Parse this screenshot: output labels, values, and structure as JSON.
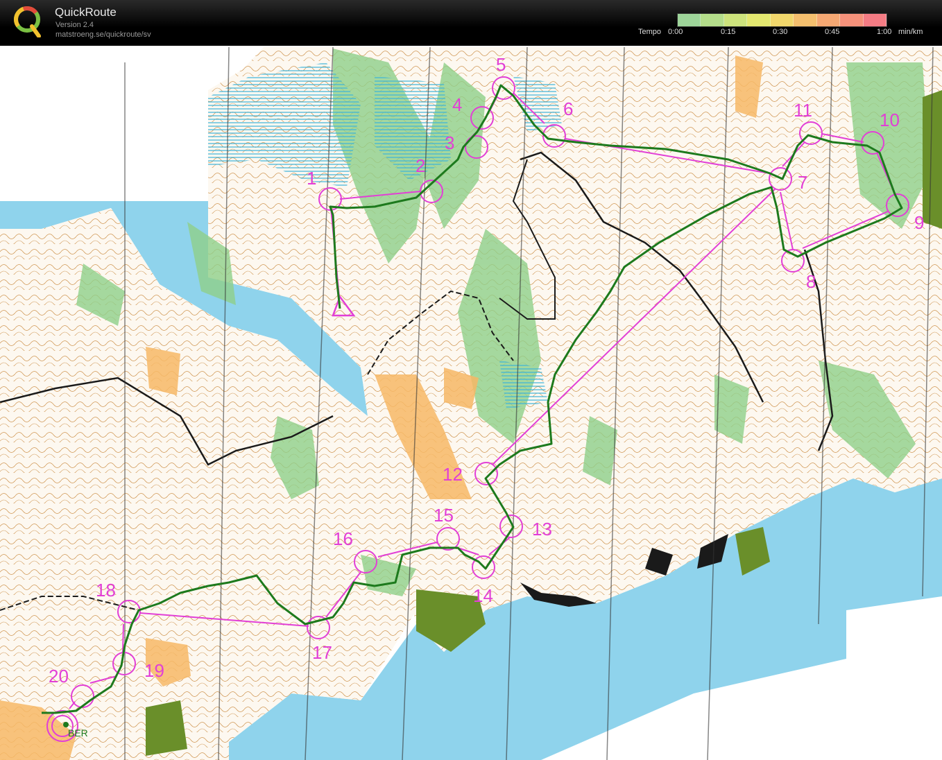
{
  "app": {
    "title": "QuickRoute",
    "version": "Version 2.4",
    "url": "matstroeng.se/quickroute/sv"
  },
  "tempo": {
    "label_prefix": "Tempo",
    "ticks": [
      "0:00",
      "0:15",
      "0:30",
      "0:45",
      "1:00"
    ],
    "unit": "min/km",
    "scale_colors": [
      "#9ed59a",
      "#b4dd8a",
      "#cde37c",
      "#e3e76f",
      "#f1d76c",
      "#f4bf6e",
      "#f5a873",
      "#f5917a",
      "#f47c84"
    ]
  },
  "map": {
    "colors": {
      "water": "#8fd3ec",
      "forest_open": "#fefefe",
      "green": "#8fd08a",
      "rough_open": "#f7b866",
      "course": "#e23fd6",
      "route": "#1d7a1d",
      "cliff": "#1a1a1a",
      "urban": "#6a8f2a"
    },
    "start_label": "BER",
    "controls": [
      {
        "number": "1"
      },
      {
        "number": "2"
      },
      {
        "number": "3"
      },
      {
        "number": "4"
      },
      {
        "number": "5"
      },
      {
        "number": "6"
      },
      {
        "number": "7"
      },
      {
        "number": "8"
      },
      {
        "number": "9"
      },
      {
        "number": "10"
      },
      {
        "number": "11"
      },
      {
        "number": "12"
      },
      {
        "number": "13"
      },
      {
        "number": "14"
      },
      {
        "number": "15"
      },
      {
        "number": "16"
      },
      {
        "number": "17"
      },
      {
        "number": "18"
      },
      {
        "number": "19"
      },
      {
        "number": "20"
      }
    ]
  }
}
